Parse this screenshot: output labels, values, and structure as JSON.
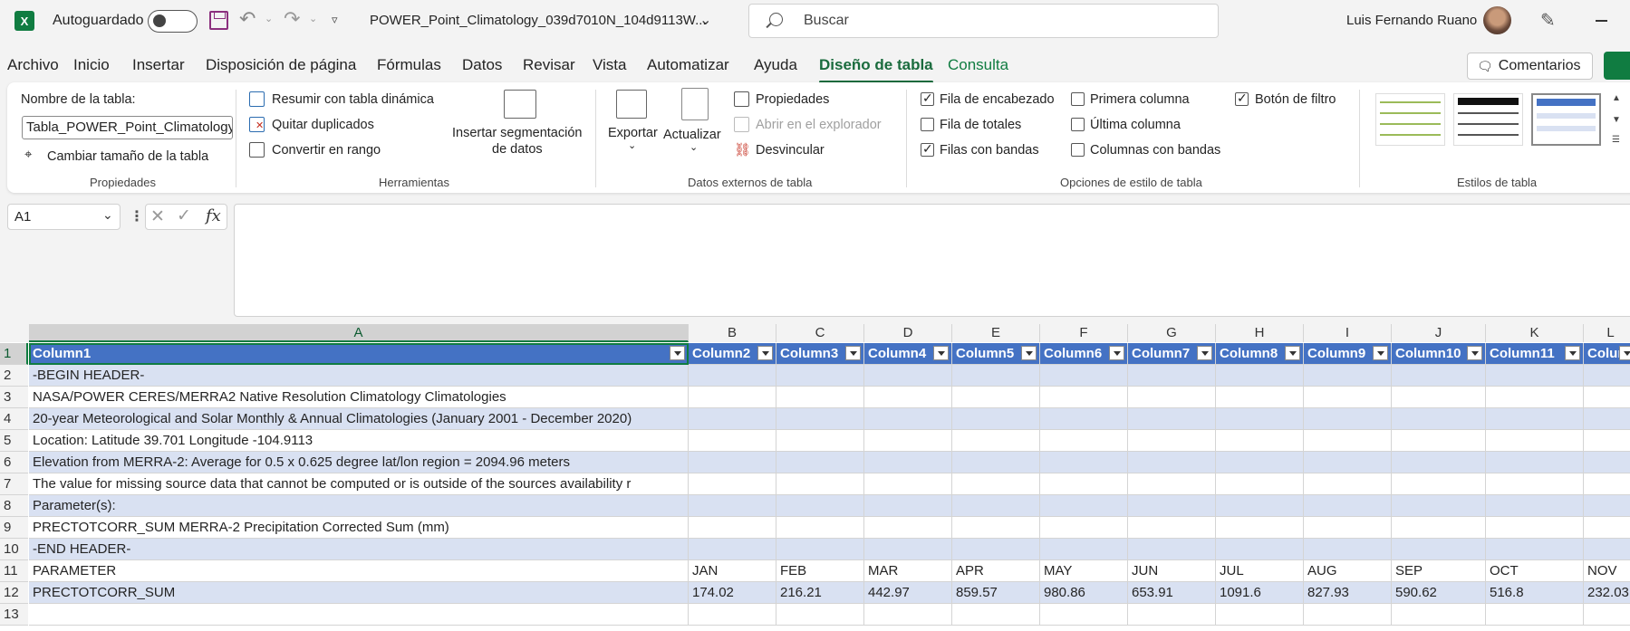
{
  "titlebar": {
    "autosave_label": "Autoguardado",
    "filename": "POWER_Point_Climatology_039d7010N_104d9113W...",
    "search_placeholder": "Buscar",
    "username": "Luis Fernando Ruano",
    "autosave_on": false
  },
  "menu": {
    "tabs": [
      "Archivo",
      "Inicio",
      "Insertar",
      "Disposición de página",
      "Fórmulas",
      "Datos",
      "Revisar",
      "Vista",
      "Automatizar",
      "Ayuda",
      "Diseño de tabla",
      "Consulta"
    ],
    "active_tab": "Diseño de tabla",
    "comments_label": "Comentarios"
  },
  "ribbon": {
    "propiedades": {
      "table_name_label": "Nombre de la tabla:",
      "table_name_value": "Tabla_POWER_Point_Climatology",
      "resize_label": "Cambiar tamaño de la tabla",
      "group_label": "Propiedades"
    },
    "herramientas": {
      "pivot_label": "Resumir con tabla dinámica",
      "remove_dup_label": "Quitar duplicados",
      "convert_label": "Convertir en rango",
      "slicer_label_1": "Insertar segmentación",
      "slicer_label_2": "de datos",
      "group_label": "Herramientas"
    },
    "externos": {
      "export_label": "Exportar",
      "refresh_label": "Actualizar",
      "properties_label": "Propiedades",
      "open_browser_label": "Abrir en el explorador",
      "unlink_label": "Desvincular",
      "group_label": "Datos externos de tabla"
    },
    "opciones": {
      "header_row": {
        "label": "Fila de encabezado",
        "checked": true
      },
      "total_row": {
        "label": "Fila de totales",
        "checked": false
      },
      "banded_rows": {
        "label": "Filas con bandas",
        "checked": true
      },
      "first_column": {
        "label": "Primera columna",
        "checked": false
      },
      "last_column": {
        "label": "Última columna",
        "checked": false
      },
      "banded_columns": {
        "label": "Columnas con bandas",
        "checked": false
      },
      "filter_button": {
        "label": "Botón de filtro",
        "checked": true
      },
      "group_label": "Opciones de estilo de tabla"
    },
    "estilos": {
      "group_label": "Estilos de tabla"
    }
  },
  "formula_bar": {
    "name_box": "A1",
    "formula": ""
  },
  "sheet": {
    "column_letters": [
      "A",
      "B",
      "C",
      "D",
      "E",
      "F",
      "G",
      "H",
      "I",
      "J",
      "K",
      "L"
    ],
    "header_row": [
      "Column1",
      "Column2",
      "Column3",
      "Column4",
      "Column5",
      "Column6",
      "Column7",
      "Column8",
      "Column9",
      "Column10",
      "Column11",
      "Colum"
    ],
    "row_numbers": [
      "1",
      "2",
      "3",
      "4",
      "5",
      "6",
      "7",
      "8",
      "9",
      "10",
      "11",
      "12",
      "13"
    ],
    "a_column": [
      "-BEGIN HEADER-",
      "NASA/POWER CERES/MERRA2 Native Resolution Climatology Climatologies",
      "20-year Meteorological and Solar Monthly & Annual Climatologies (January 2001 - December 2020)",
      "Location: Latitude  39.701   Longitude -104.9113",
      "Elevation from MERRA-2: Average for 0.5 x 0.625 degree lat/lon region = 2094.96 meters",
      "The value for missing source data that cannot be computed or is outside of the sources availability r",
      "Parameter(s):",
      "PRECTOTCORR_SUM     MERRA-2 Precipitation Corrected Sum (mm)",
      "-END HEADER-",
      "PARAMETER",
      "PRECTOTCORR_SUM",
      ""
    ],
    "month_row": [
      "JAN",
      "FEB",
      "MAR",
      "APR",
      "MAY",
      "JUN",
      "JUL",
      "AUG",
      "SEP",
      "OCT",
      "NOV"
    ],
    "value_row": [
      "174.02",
      "216.21",
      "442.97",
      "859.57",
      "980.86",
      "653.91",
      "1091.6",
      "827.93",
      "590.62",
      "516.8",
      "232.03"
    ]
  },
  "colors": {
    "accent": "#107c41",
    "table_header": "#4472c4",
    "band": "#d9e1f2"
  }
}
